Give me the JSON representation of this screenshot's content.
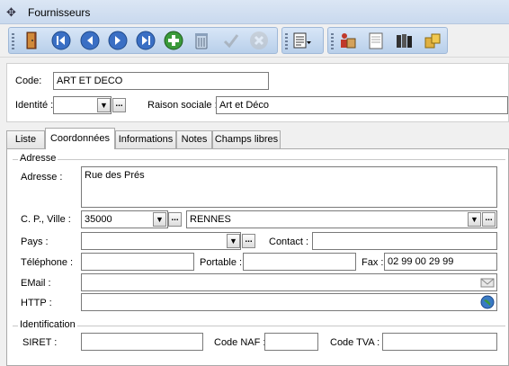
{
  "window": {
    "title": "Fournisseurs"
  },
  "toolbar": {
    "icons": [
      "door-exit-icon",
      "first-record-icon",
      "previous-record-icon",
      "next-record-icon",
      "last-record-icon",
      "add-record-icon",
      "delete-record-icon",
      "validate-icon",
      "cancel-icon",
      "report-menu-icon",
      "customers-icon",
      "document-icon",
      "books-icon",
      "products-icon"
    ]
  },
  "header": {
    "code_label": "Code:",
    "code_value": "ART ET DECO",
    "identite_label": "Identité :",
    "identite_value": "",
    "raison_label": "Raison sociale :",
    "raison_value": "Art et Déco"
  },
  "tabs": [
    "Liste",
    "Coordonnées",
    "Informations",
    "Notes",
    "Champs libres"
  ],
  "adresse_group": {
    "title": "Adresse",
    "adresse_label": "Adresse :",
    "adresse_value": "Rue des Prés",
    "cp_ville_label": "C. P., Ville :",
    "cp_value": "35000",
    "ville_value": "RENNES",
    "pays_label": "Pays :",
    "pays_value": "",
    "contact_label": "Contact :",
    "contact_value": "",
    "telephone_label": "Téléphone :",
    "telephone_value": "",
    "portable_label": "Portable :",
    "portable_value": "",
    "fax_label": "Fax :",
    "fax_value": "02 99 00 29 99",
    "email_label": "EMail :",
    "email_value": "",
    "http_label": "HTTP :",
    "http_value": ""
  },
  "identification_group": {
    "title": "Identification",
    "siret_label": "SIRET :",
    "siret_value": "",
    "naf_label": "Code NAF :",
    "naf_value": "",
    "tva_label": "Code TVA :",
    "tva_value": ""
  },
  "glyphs": {
    "dropdown": "▼",
    "ellipsis": "..."
  },
  "colors": {
    "toolbar_blue": "#3a6fc4",
    "accent_green": "#3a9a3a"
  }
}
